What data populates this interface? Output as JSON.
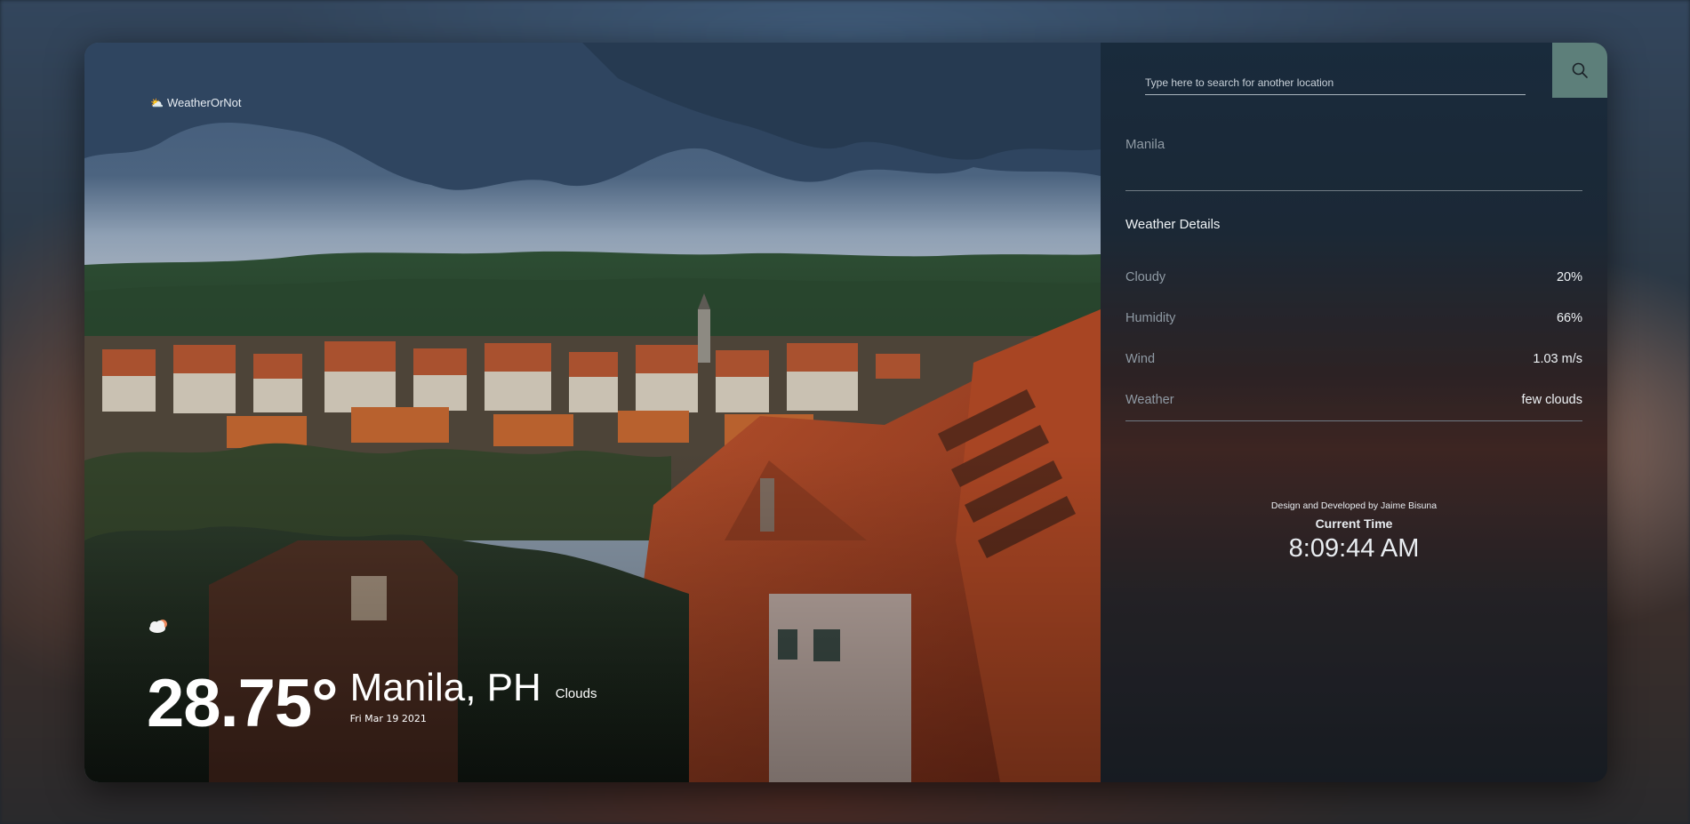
{
  "brand": {
    "name": "WeatherOrNot",
    "icon": "sun-cloud-icon"
  },
  "current": {
    "temperature": "28.75°",
    "location": "Manila, PH",
    "date": "Fri Mar 19 2021",
    "condition": "Clouds",
    "condition_icon": "cloud-icon"
  },
  "search": {
    "placeholder": "Type here to search for another location",
    "button_icon": "search-icon"
  },
  "saved_locations": [
    "Manila"
  ],
  "details": {
    "title": "Weather Details",
    "rows": [
      {
        "label": "Cloudy",
        "value": "20%"
      },
      {
        "label": "Humidity",
        "value": "66%"
      },
      {
        "label": "Wind",
        "value": "1.03 m/s"
      },
      {
        "label": "Weather",
        "value": "few clouds"
      }
    ]
  },
  "footer": {
    "credit": "Design and Developed by Jaime Bisuna",
    "time_label": "Current Time",
    "time_value": "8:09:44 AM"
  },
  "colors": {
    "search_button": "#5d7f7a",
    "muted_text": "#8f9aa4",
    "text": "#eef2f5"
  }
}
